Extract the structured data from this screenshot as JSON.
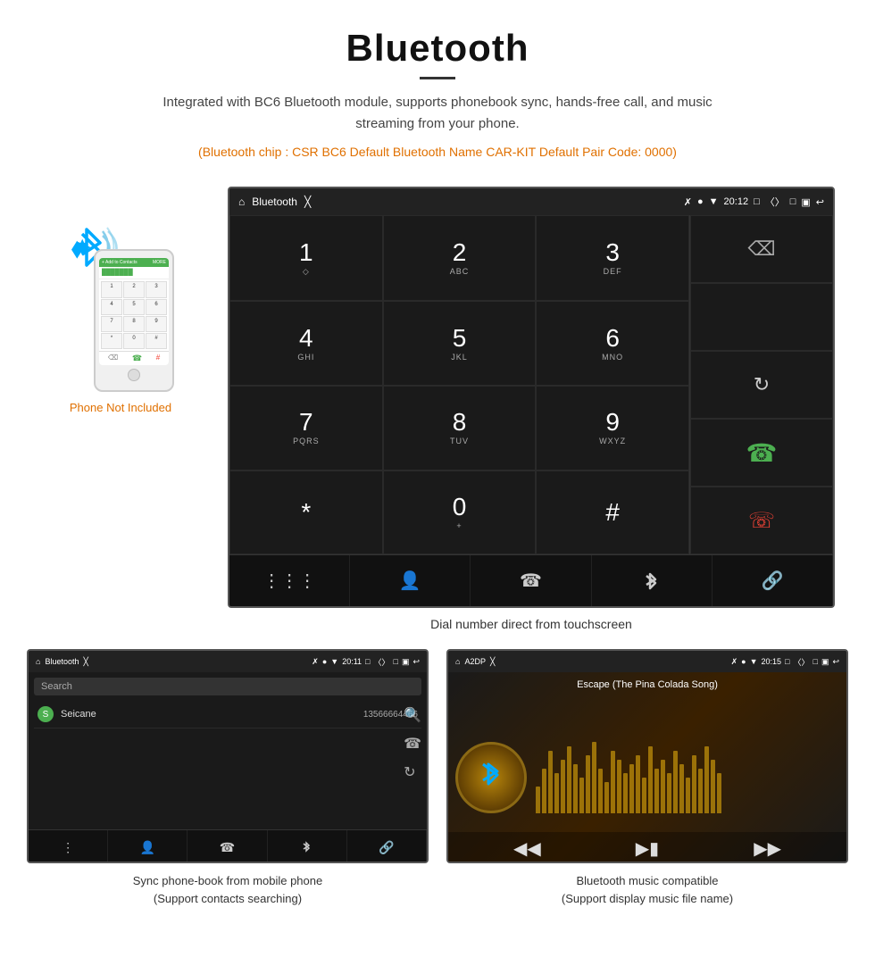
{
  "header": {
    "title": "Bluetooth",
    "description": "Integrated with BC6 Bluetooth module, supports phonebook sync, hands-free call, and music streaming from your phone.",
    "specs": "(Bluetooth chip : CSR BC6    Default Bluetooth Name CAR-KIT    Default Pair Code: 0000)",
    "caption_main": "Dial number direct from touchscreen"
  },
  "phone_label": "Phone Not Included",
  "status_bar": {
    "app_name": "Bluetooth",
    "time": "20:12"
  },
  "dialpad": {
    "keys": [
      {
        "num": "1",
        "letters": ""
      },
      {
        "num": "2",
        "letters": "ABC"
      },
      {
        "num": "3",
        "letters": "DEF"
      },
      {
        "num": "4",
        "letters": "GHI"
      },
      {
        "num": "5",
        "letters": "JKL"
      },
      {
        "num": "6",
        "letters": "MNO"
      },
      {
        "num": "7",
        "letters": "PQRS"
      },
      {
        "num": "8",
        "letters": "TUV"
      },
      {
        "num": "9",
        "letters": "WXYZ"
      },
      {
        "num": "*",
        "letters": ""
      },
      {
        "num": "0",
        "letters": "+"
      },
      {
        "num": "#",
        "letters": ""
      }
    ]
  },
  "toolbar": {
    "buttons": [
      "grid",
      "person",
      "phone",
      "bluetooth",
      "link"
    ]
  },
  "bottom_left": {
    "status_app": "Bluetooth",
    "time": "20:11",
    "search_placeholder": "Search",
    "contacts": [
      {
        "letter": "S",
        "name": "Seicane",
        "number": "13566664466"
      }
    ],
    "caption": "Sync phone-book from mobile phone\n(Support contacts searching)"
  },
  "bottom_right": {
    "status_app": "A2DP",
    "time": "20:15",
    "song_title": "Escape (The Pina Colada Song)",
    "caption": "Bluetooth music compatible\n(Support display music file name)"
  },
  "eq_bars": [
    30,
    50,
    70,
    45,
    60,
    75,
    55,
    40,
    65,
    80,
    50,
    35,
    70,
    60,
    45,
    55,
    65,
    40,
    75,
    50,
    60,
    45,
    70,
    55,
    40,
    65,
    50,
    75,
    60,
    45
  ]
}
